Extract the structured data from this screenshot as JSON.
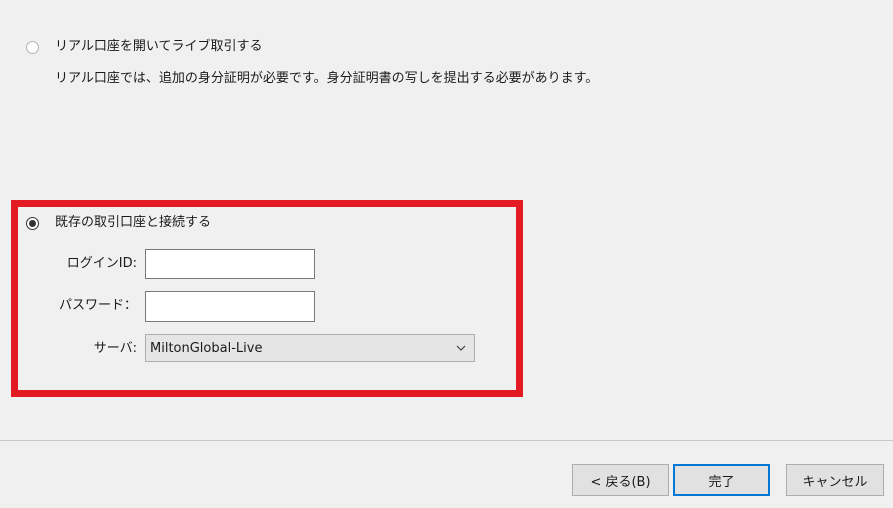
{
  "options": {
    "live": {
      "label": "リアル口座を開いてライブ取引する",
      "description": "リアル口座では、追加の身分証明が必要です。身分証明書の写しを提出する必要があります。",
      "selected": false
    },
    "existing": {
      "label": "既存の取引口座と接続する",
      "selected": true
    }
  },
  "form": {
    "login_label": "ログインID:",
    "login_value": "",
    "password_label": "パスワード：",
    "password_value": "",
    "server_label": "サーバ:",
    "server_value": "MiltonGlobal-Live"
  },
  "buttons": {
    "back": "< 戻る(B)",
    "finish": "完了",
    "cancel": "キャンセル"
  },
  "colors": {
    "highlight": "#e31b23",
    "primary_border": "#0078d7",
    "background": "#f0f0f0"
  }
}
